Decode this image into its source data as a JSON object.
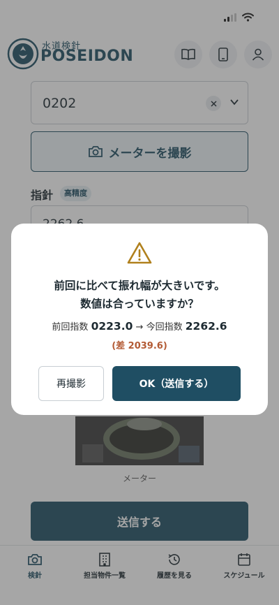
{
  "status_bar": {
    "signal": "cellular-signal-icon",
    "wifi": "wifi-icon"
  },
  "header": {
    "brand_sub": "水道検針",
    "brand_name": "POSEIDON",
    "logo_text": "POSEIDON",
    "buttons": [
      "book-icon",
      "mobile-phone-icon",
      "user-icon"
    ]
  },
  "form": {
    "select_value": "0202",
    "camera_button_label": "メーターを撮影",
    "reading_label": "指針",
    "precision_badge": "高精度",
    "reading_value": "2262.6",
    "photo_caption": "メーター",
    "submit_label": "送信する"
  },
  "nav": {
    "items": [
      {
        "label": "検針",
        "icon": "camera-icon"
      },
      {
        "label": "担当物件一覧",
        "icon": "building-icon"
      },
      {
        "label": "履歴を見る",
        "icon": "history-icon"
      },
      {
        "label": "スケジュール",
        "icon": "calendar-icon"
      }
    ]
  },
  "dialog": {
    "icon": "warning-icon",
    "title_line1": "前回に比べて振れ幅が大きいです。",
    "title_line2": "数値は合っていますか？",
    "prev_label": "前回指数",
    "prev_value": "0223.0",
    "arrow": "→",
    "curr_label": "今回指数",
    "curr_value": "2262.6",
    "diff_text": "(差 2039.6)",
    "retake_label": "再撮影",
    "ok_label": "OK（送信する）"
  },
  "colors": {
    "brand": "#1f4e63",
    "diff_accent": "#b35b35",
    "warning": "#b0801c"
  }
}
